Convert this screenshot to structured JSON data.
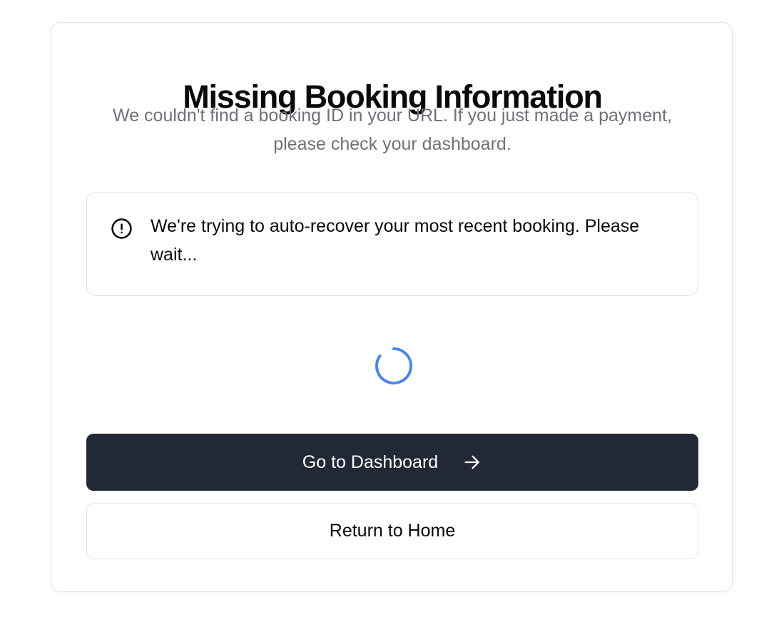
{
  "card": {
    "title": "Missing Booking Information",
    "subtitle": "We couldn't find a booking ID in your URL. If you just made a payment, please check your dashboard."
  },
  "alert": {
    "icon": "alert-circle-icon",
    "message": "We're trying to auto-recover your most recent booking. Please wait..."
  },
  "spinner": {
    "icon": "loading-spinner-icon",
    "color": "#4a86e8"
  },
  "buttons": {
    "dashboard_label": "Go to Dashboard",
    "dashboard_icon": "arrow-right-icon",
    "home_label": "Return to Home"
  },
  "colors": {
    "primary_button": "#222836",
    "border": "#e4e4e7",
    "muted_text": "#71717a"
  }
}
